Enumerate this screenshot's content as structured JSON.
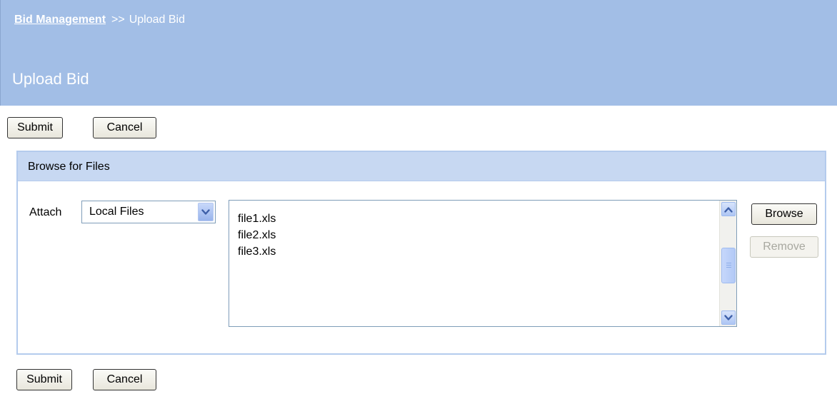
{
  "breadcrumb": {
    "link": "Bid Management",
    "separator": ">>",
    "current": "Upload Bid"
  },
  "page_title": "Upload Bid",
  "toolbar_top": {
    "submit": "Submit",
    "cancel": "Cancel"
  },
  "toolbar_bottom": {
    "submit": "Submit",
    "cancel": "Cancel"
  },
  "panel": {
    "title": "Browse for Files",
    "attach_label": "Attach",
    "attach_select": {
      "value": "Local Files"
    },
    "files": [
      "file1.xls",
      "file2.xls",
      "file3.xls"
    ],
    "browse_button": "Browse",
    "remove_button": "Remove"
  },
  "colors": {
    "header_bg": "#a2bee6",
    "panel_header_bg": "#c7d8f2",
    "panel_border": "#b4cbed",
    "scrollbar_accent": "#aec6f4"
  },
  "icons": {
    "select_arrow": "chevron-down-icon",
    "scroll_up": "chevron-up-icon",
    "scroll_down": "chevron-down-icon",
    "scroll_thumb": "grip-icon"
  }
}
